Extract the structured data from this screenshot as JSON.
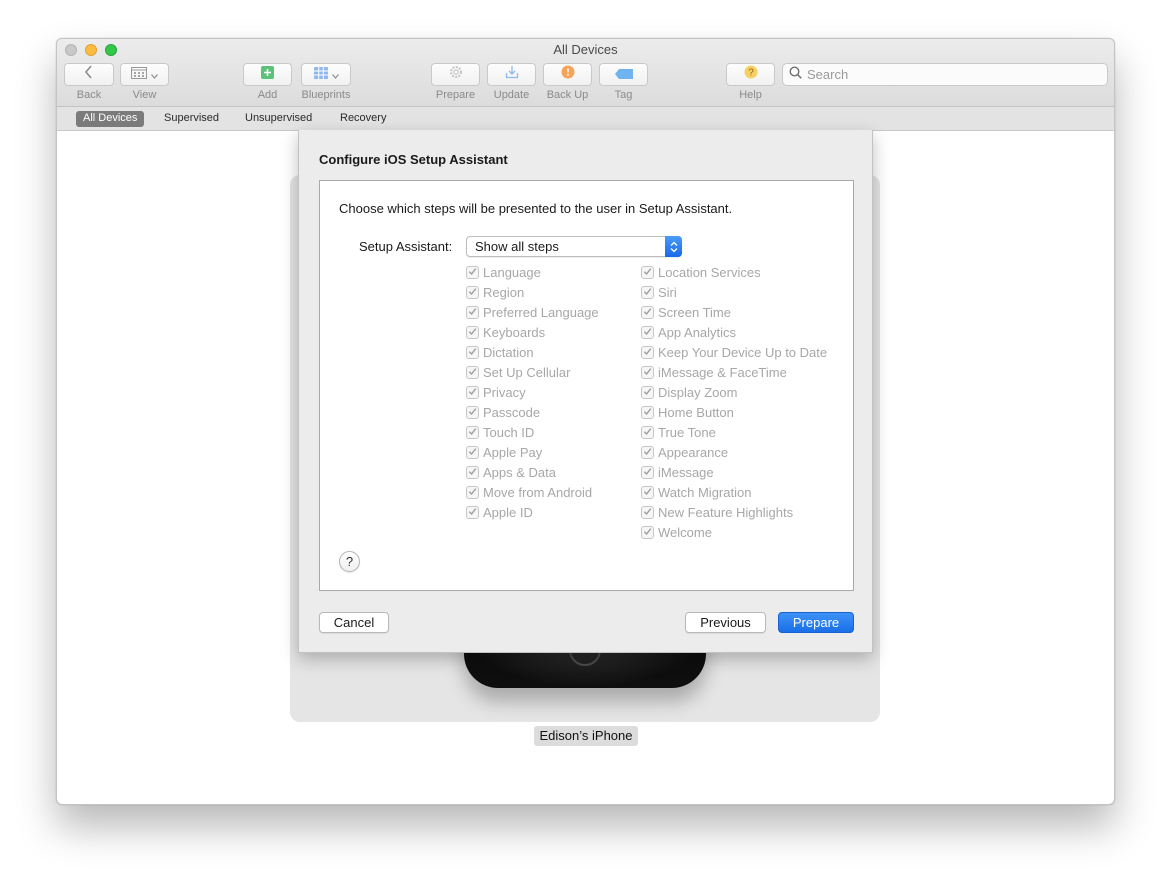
{
  "window": {
    "title": "All Devices"
  },
  "toolbar": {
    "back": "Back",
    "view": "View",
    "add": "Add",
    "blueprints": "Blueprints",
    "prepare": "Prepare",
    "update": "Update",
    "backup": "Back Up",
    "tag": "Tag",
    "help": "Help",
    "search_placeholder": "Search"
  },
  "filters": {
    "all_devices": "All Devices",
    "supervised": "Supervised",
    "unsupervised": "Unsupervised",
    "recovery": "Recovery",
    "active": "All Devices"
  },
  "device": {
    "name": "Edison’s iPhone"
  },
  "sheet": {
    "title": "Configure iOS Setup Assistant",
    "instruction": "Choose which steps will be presented to the user in Setup Assistant.",
    "setup_label": "Setup Assistant:",
    "setup_value": "Show all steps",
    "help": "?",
    "left_steps": [
      {
        "label": "Language",
        "checked": true
      },
      {
        "label": "Region",
        "checked": true
      },
      {
        "label": "Preferred Language",
        "checked": true
      },
      {
        "label": "Keyboards",
        "checked": true
      },
      {
        "label": "Dictation",
        "checked": true
      },
      {
        "label": "Set Up Cellular",
        "checked": true
      },
      {
        "label": "Privacy",
        "checked": true
      },
      {
        "label": "Passcode",
        "checked": true
      },
      {
        "label": "Touch ID",
        "checked": true
      },
      {
        "label": "Apple Pay",
        "checked": true
      },
      {
        "label": "Apps & Data",
        "checked": true
      },
      {
        "label": "Move from Android",
        "checked": true
      },
      {
        "label": "Apple ID",
        "checked": true
      }
    ],
    "right_steps": [
      {
        "label": "Location Services",
        "checked": true
      },
      {
        "label": "Siri",
        "checked": true
      },
      {
        "label": "Screen Time",
        "checked": true
      },
      {
        "label": "App Analytics",
        "checked": true
      },
      {
        "label": "Keep Your Device Up to Date",
        "checked": true
      },
      {
        "label": "iMessage & FaceTime",
        "checked": true
      },
      {
        "label": "Display Zoom",
        "checked": true
      },
      {
        "label": "Home Button",
        "checked": true
      },
      {
        "label": "True Tone",
        "checked": true
      },
      {
        "label": "Appearance",
        "checked": true
      },
      {
        "label": "iMessage",
        "checked": true
      },
      {
        "label": "Watch Migration",
        "checked": true
      },
      {
        "label": "New Feature Highlights",
        "checked": true
      },
      {
        "label": "Welcome",
        "checked": true
      }
    ],
    "buttons": {
      "cancel": "Cancel",
      "previous": "Previous",
      "prepare": "Prepare"
    }
  },
  "colors": {
    "accent": "#1a6fe8",
    "add_icon": "#5cc27a",
    "backup_icon": "#f5a45a",
    "help_icon": "#f7cf62",
    "tag_icon": "#6fb3f0"
  }
}
